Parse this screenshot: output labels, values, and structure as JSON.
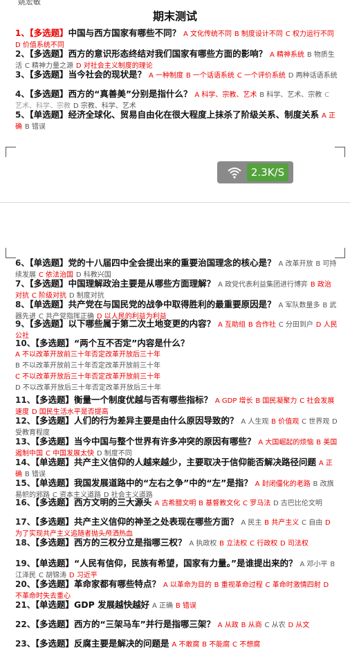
{
  "top_cut_text": "姚宏敏",
  "title": "期末测试",
  "network_speed": "2.3K/S",
  "questions_page1": [
    {
      "num": "1、",
      "type": "【多选题】",
      "text": "中国与西方国家有哪些不同？",
      "options": [
        {
          "t": "A 文化传统不同",
          "c": "red"
        },
        {
          "t": "B 制度设计不同",
          "c": "red"
        },
        {
          "t": "C 权力运行不同",
          "c": "red"
        },
        {
          "t": "D 价值系统不同",
          "c": "red"
        }
      ]
    },
    {
      "num": "2、",
      "type": "【多选题】",
      "text": "西方的意识形态终结对我们国家有哪些方面的影响？",
      "options": [
        {
          "t": "A 精神系统",
          "c": "red"
        },
        {
          "t": "B 物质生活",
          "c": "gray"
        },
        {
          "t": "C 精神力量之源",
          "c": "gray"
        },
        {
          "t": "D 对社会主义制度的理论",
          "c": "red"
        }
      ]
    },
    {
      "num": "3、",
      "type": "【多选题】",
      "text": "当今社会的现状是？",
      "options": [
        {
          "t": "A 一种制度",
          "c": "red"
        },
        {
          "t": "B 一个话语系统",
          "c": "red"
        },
        {
          "t": "C 一个评价系统",
          "c": "red"
        },
        {
          "t": "D 两种话语系统",
          "c": "gray"
        }
      ]
    },
    {
      "num": "4、",
      "type": "【多选题】",
      "text": "西方的“真善美”分别是指什么？",
      "options": [
        {
          "t": "A 科学、宗教、艺术",
          "c": "red"
        },
        {
          "t": "B 科学、艺术、宗教",
          "c": "gray"
        },
        {
          "t": "C 艺术、科学、宗教",
          "c": "lightgray"
        },
        {
          "t": "D 宗教、科学、艺术",
          "c": "gray"
        }
      ]
    },
    {
      "num": "5、",
      "type": "【单选题】",
      "text": "经济全球化、贸易自由化在很大程度上抹杀了阶级关系、制度关系",
      "options": [
        {
          "t": "A 正确",
          "c": "red"
        },
        {
          "t": "B 错误",
          "c": "gray"
        }
      ]
    }
  ],
  "questions_page2": [
    {
      "num": "6、",
      "type": "【单选题】",
      "text": "党的十八届四中全会提出来的重要治国理念的核心是？",
      "options": [
        {
          "t": "A 改革开放",
          "c": "gray"
        },
        {
          "t": "B 可持续发展",
          "c": "gray"
        },
        {
          "t": "C 依法治国",
          "c": "red"
        },
        {
          "t": "D 科教兴国",
          "c": "gray"
        }
      ]
    },
    {
      "num": "7、",
      "type": "【多选题】",
      "text": "中国理解政治主要是从哪些方面理解？",
      "options": [
        {
          "t": "A 政党代表利益集团进行博弈",
          "c": "gray"
        },
        {
          "t": "B 政治对抗",
          "c": "red"
        },
        {
          "t": "C 阶级对抗",
          "c": "red"
        },
        {
          "t": "D 制度对抗",
          "c": "gray"
        }
      ]
    },
    {
      "num": "8、",
      "type": "【单选题】",
      "text": "共产党在与国民党的战争中取得胜利的最重要原因是？",
      "options": [
        {
          "t": "A 军队数量多",
          "c": "gray"
        },
        {
          "t": "B 武器先进",
          "c": "gray"
        },
        {
          "t": "C 共产党指挥正确",
          "c": "gray"
        },
        {
          "t": "D 以人民的利益为利益",
          "c": "red"
        }
      ]
    },
    {
      "num": "9、",
      "type": "【多选题】",
      "text": "以下哪些属于第二次土地变更的内容？",
      "options": [
        {
          "t": "A 互助组",
          "c": "red"
        },
        {
          "t": "B 合作社",
          "c": "red"
        },
        {
          "t": "C 分田到户",
          "c": "gray"
        },
        {
          "t": "D 人民公社",
          "c": "red"
        }
      ]
    },
    {
      "num": "10、",
      "type": "【多选题】",
      "text": "“两个互不否定”内容是什么？",
      "options": [
        {
          "t": "A 不以改革开放前三十年否定改革开放后三十年",
          "c": "red",
          "br": true
        },
        {
          "t": "B 不以改革开放前三十年否定改革开放前三十年",
          "c": "gray",
          "br": true
        },
        {
          "t": "C 不以改革开放后三十年否定改革开放前三十年",
          "c": "red",
          "br": true
        },
        {
          "t": "D 不以改革开放后三十年否定改革开放后三十年",
          "c": "gray",
          "br": true
        }
      ]
    },
    {
      "num": "11、",
      "type": "【多选题】",
      "text": "衡量一个制度优越与否有哪些指标？",
      "options": [
        {
          "t": "A GDP 增长",
          "c": "red"
        },
        {
          "t": "B 国民凝聚力",
          "c": "red"
        },
        {
          "t": "C 社会发展速度",
          "c": "red"
        },
        {
          "t": "D 国民生活水平是否提高",
          "c": "red"
        }
      ]
    },
    {
      "num": "12、",
      "type": "【多选题】",
      "text": "人们的行为差异主要是由什么原因导致的？",
      "options": [
        {
          "t": "A 人生观",
          "c": "gray"
        },
        {
          "t": "B 价值观",
          "c": "red"
        },
        {
          "t": "C 世界观",
          "c": "gray"
        },
        {
          "t": "D 受教育程度",
          "c": "gray"
        }
      ]
    },
    {
      "num": "13、",
      "type": "【多选题】",
      "text": "当今中国与整个世界有许多冲突的原因有哪些？",
      "options": [
        {
          "t": "A 大国崛起的烦恼",
          "c": "red"
        },
        {
          "t": "B 美国遏制中国",
          "c": "red"
        },
        {
          "t": "C 中国发展太快",
          "c": "red"
        },
        {
          "t": "D 制度不同",
          "c": "gray"
        }
      ]
    },
    {
      "num": "14、",
      "type": "【单选题】",
      "text": "共产主义信仰的人越来越少，主要取决于信仰能否解决路径问题",
      "options": [
        {
          "t": "A 正确",
          "c": "red"
        },
        {
          "t": "B 错误",
          "c": "gray"
        }
      ]
    },
    {
      "num": "15、",
      "type": "【单选题】",
      "text": "我国发展道路中的“左右之争”中的“左”是指？",
      "options": [
        {
          "t": "A 封闭僵化的老路",
          "c": "red"
        },
        {
          "t": "B 改旗易帜的邪路",
          "c": "gray"
        },
        {
          "t": "C 资本主义道路",
          "c": "gray"
        },
        {
          "t": "D 社会主义道路",
          "c": "gray"
        }
      ]
    },
    {
      "num": "16、",
      "type": "【多选题】",
      "text": "西方文明的三大源头",
      "options": [
        {
          "t": "A 古希腊文明",
          "c": "red"
        },
        {
          "t": "B 基督教文化",
          "c": "red"
        },
        {
          "t": "C 罗马法",
          "c": "red"
        },
        {
          "t": "D 古巴比伦文明",
          "c": "gray"
        }
      ]
    },
    {
      "num": "17、",
      "type": "【多选题】",
      "text": "共产主义信仰的神圣之处表现在哪些方面？",
      "options": [
        {
          "t": "A 民主",
          "c": "gray"
        },
        {
          "t": "B 共产主义",
          "c": "red"
        },
        {
          "t": "C 自由",
          "c": "gray"
        },
        {
          "t": "D 为了实现共产主义追随者抛头颅洒热血",
          "c": "red"
        }
      ]
    },
    {
      "num": "18、",
      "type": "【多选题】",
      "text": "西方的三权分立是指哪三权？",
      "options": [
        {
          "t": "A 执政权",
          "c": "gray"
        },
        {
          "t": "B 立法权",
          "c": "red"
        },
        {
          "t": "C 行政权",
          "c": "red"
        },
        {
          "t": "D 司法权",
          "c": "red"
        }
      ]
    },
    {
      "num": "19、",
      "type": "【单选题】",
      "text": "“人民有信仰，民族有希望，国家有力量。”是谁提出来的？",
      "options": [
        {
          "t": "A 邓小平",
          "c": "gray"
        },
        {
          "t": "B 江泽民",
          "c": "gray"
        },
        {
          "t": "C 胡锦涛",
          "c": "gray"
        },
        {
          "t": "D 习近平",
          "c": "red"
        }
      ]
    },
    {
      "num": "20、",
      "type": "【多选题】",
      "text": "革命家都有哪些特点？",
      "options": [
        {
          "t": "A 以革命为目的",
          "c": "red"
        },
        {
          "t": "B 重视革命过程",
          "c": "red"
        },
        {
          "t": "C 革命时激情四射",
          "c": "red"
        },
        {
          "t": "D 不革命时失去重心",
          "c": "red"
        }
      ]
    },
    {
      "num": "21、",
      "type": "【单选题】",
      "text": "GDP 发展越快越好",
      "options": [
        {
          "t": "A 正确",
          "c": "gray"
        },
        {
          "t": "B 错误",
          "c": "red"
        }
      ]
    },
    {
      "num": "22、",
      "type": "【多选题】",
      "text": "西方的“三架马车”并行是指哪三架？",
      "options": [
        {
          "t": "A 从政",
          "c": "red"
        },
        {
          "t": "B 从商",
          "c": "red"
        },
        {
          "t": "C 从农",
          "c": "gray"
        },
        {
          "t": "D 从文",
          "c": "red"
        }
      ]
    },
    {
      "num": "23、",
      "type": "【多选题】",
      "text": "反腐主要是解决的问题是",
      "options": [
        {
          "t": "A 不敢腐",
          "c": "red"
        },
        {
          "t": "B 不能腐",
          "c": "red"
        },
        {
          "t": "C 不想腐",
          "c": "red"
        }
      ]
    }
  ]
}
